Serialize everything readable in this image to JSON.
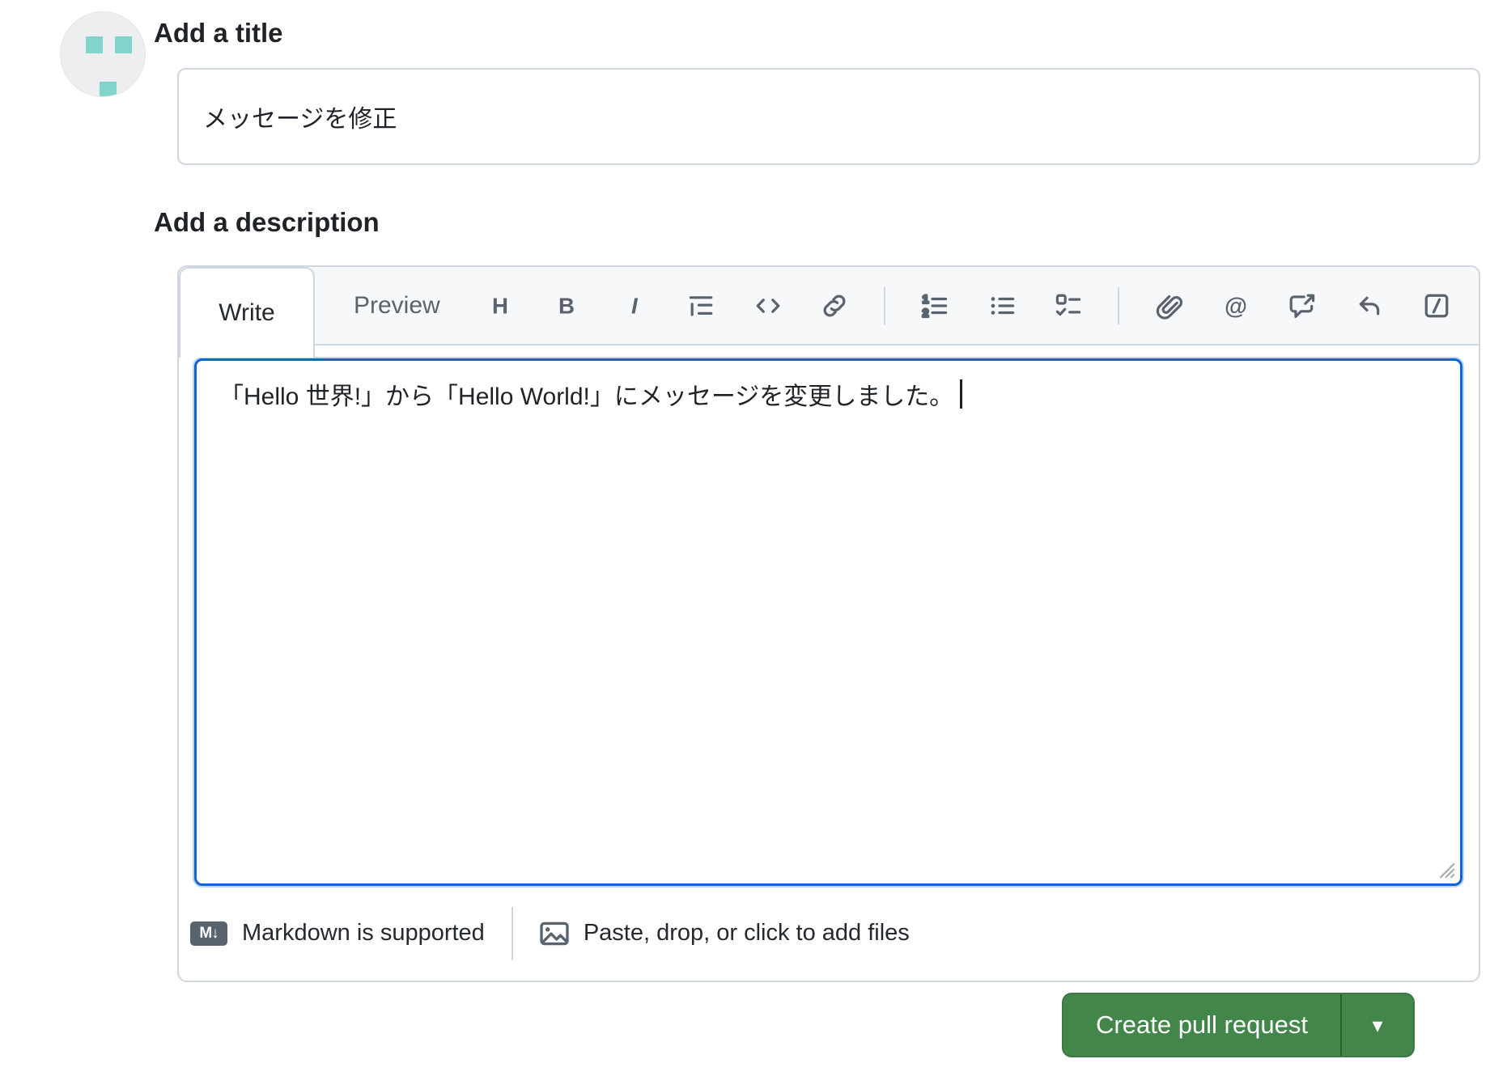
{
  "avatar": {
    "type": "identicon",
    "teal": "#82d3cb"
  },
  "title_section": {
    "heading": "Add a title",
    "value": "メッセージを修正"
  },
  "description_section": {
    "heading": "Add a description",
    "tabs": [
      {
        "label": "Write",
        "active": true
      },
      {
        "label": "Preview",
        "active": false
      }
    ],
    "toolbar_icons": [
      "heading",
      "bold",
      "italic",
      "quote",
      "code",
      "link",
      "ordered-list",
      "unordered-list",
      "task-list",
      "attach-file",
      "mention",
      "cross-reference",
      "reply",
      "slash-commands"
    ],
    "icon_glyphs": {
      "heading": "H",
      "bold": "B",
      "italic": "I",
      "mention": "@",
      "ol_digit_top": "1",
      "ol_digit_bottom": "2"
    },
    "textarea_value": "「Hello 世界!」から「Hello World!」にメッセージを変更しました。",
    "footer": {
      "markdown_badge": "M↓",
      "markdown_note": "Markdown is supported",
      "attach_hint": "Paste, drop, or click to add files"
    }
  },
  "actions": {
    "create_button": "Create pull request",
    "dropdown_caret": "▾"
  },
  "colors": {
    "accent_green": "#42864a",
    "focus_blue": "#0f66d0",
    "border_gray": "#d0d7de",
    "toolbar_bg": "#f6f8fa",
    "icon_gray": "#59636e",
    "text": "#1f2328",
    "identicon_teal": "#82d3cb"
  }
}
